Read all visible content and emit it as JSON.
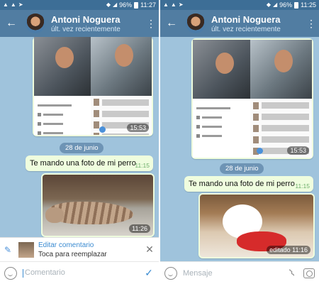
{
  "colors": {
    "header": "#517da2",
    "statusbar": "#3d6e96",
    "chat_bg": "#9fc3dc",
    "bubble_out": "#effdde",
    "accent": "#3a8bd1",
    "time_green": "#6eae6b"
  },
  "left": {
    "status": {
      "battery": "96%",
      "time": "11:27"
    },
    "header": {
      "name": "Antoni Noguera",
      "status": "últ. vez recientemente"
    },
    "shot_time": "15:53",
    "date": "28 de junio",
    "message": {
      "text": "Te mando una foto de mi perro",
      "time": "11:15"
    },
    "photo_time": "11:26",
    "edit": {
      "title": "Editar comentario",
      "subtitle": "Toca para reemplazar"
    },
    "input_placeholder": "Comentario"
  },
  "right": {
    "status": {
      "battery": "96%",
      "time": "11:25"
    },
    "header": {
      "name": "Antoni Noguera",
      "status": "últ. vez recientemente"
    },
    "shot_time": "15:53",
    "date": "28 de junio",
    "message": {
      "text": "Te mando una foto de mi perro",
      "time": "11:15"
    },
    "photo_time": "editado 11:16",
    "input_placeholder": "Mensaje"
  },
  "icons": [
    "back-arrow-icon",
    "more-vert-icon",
    "emoji-icon",
    "send-check-icon",
    "attach-clip-icon",
    "camera-icon",
    "pencil-icon",
    "close-icon"
  ]
}
